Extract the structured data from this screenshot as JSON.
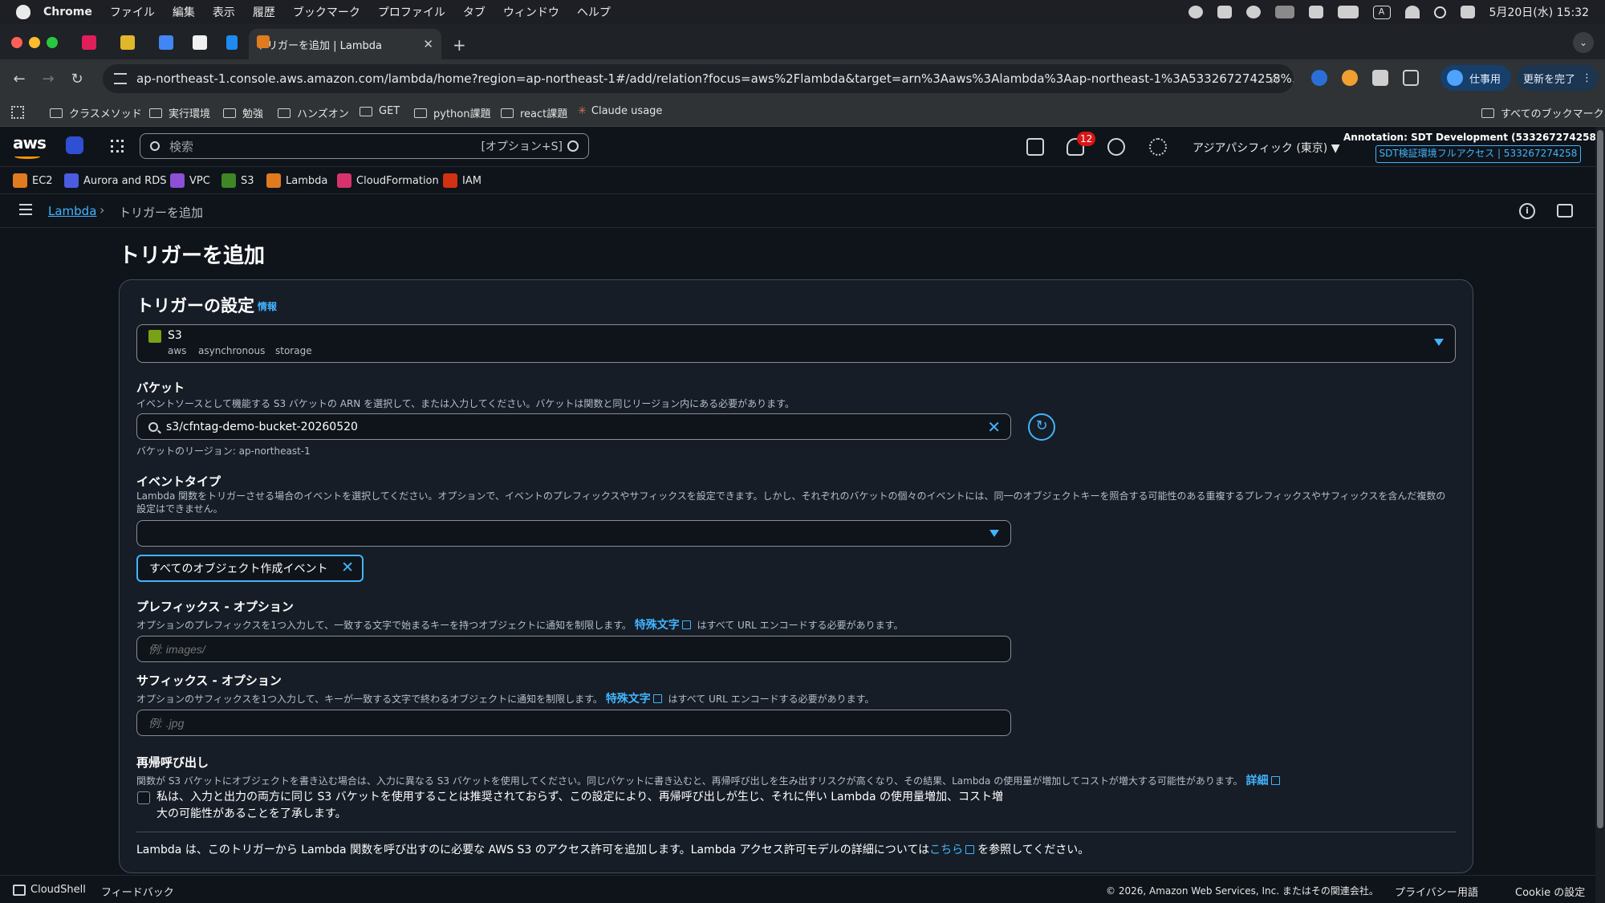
{
  "mac_menubar": {
    "app": "Chrome",
    "menus": [
      "ファイル",
      "編集",
      "表示",
      "履歴",
      "ブックマーク",
      "プロファイル",
      "タブ",
      "ウィンドウ",
      "ヘルプ"
    ],
    "clock": "5月20日(水) 15:32",
    "input_mode": "A"
  },
  "browser": {
    "active_tab_title": "トリガーを追加 | Lambda",
    "url": "ap-northeast-1.console.aws.amazon.com/lambda/home?region=ap-northeast-1#/add/relation?focus=aws%2Flambda&target=arn%3Aaws%3Alambda%3Aap-northeast-1%3A533267274258%3Afunction...",
    "profile_label": "仕事用",
    "update_label": "更新を完了",
    "bookmarks": [
      "クラスメソッド",
      "実行環境",
      "勉強",
      "ハンズオン",
      "GET",
      "python課題",
      "react課題",
      "Claude usage"
    ],
    "all_bookmarks_label": "すべてのブックマーク"
  },
  "aws_header": {
    "logo": "aws",
    "search_placeholder": "検索",
    "search_shortcut": "[オプション+S]",
    "notification_count": "12",
    "region": "アジアパシフィック (東京) ▼",
    "account_name": "Annotation: SDT Development (533267274258) ▼",
    "account_role": "SDT検証環境フルアクセス | 533267274258"
  },
  "favorites": [
    {
      "label": "EC2",
      "color": "#e07b1f"
    },
    {
      "label": "Aurora and RDS",
      "color": "#4a5ce0"
    },
    {
      "label": "VPC",
      "color": "#8c4fd6"
    },
    {
      "label": "S3",
      "color": "#3f8624"
    },
    {
      "label": "Lambda",
      "color": "#e07b1f"
    },
    {
      "label": "CloudFormation",
      "color": "#d6336c"
    },
    {
      "label": "IAM",
      "color": "#d13212"
    }
  ],
  "breadcrumb": {
    "root": "Lambda",
    "current": "トリガーを追加"
  },
  "page": {
    "title": "トリガーを追加",
    "panel_title": "トリガーの設定",
    "panel_info": "情報",
    "source": {
      "name": "S3",
      "tags": [
        "aws",
        "asynchronous",
        "storage"
      ]
    },
    "bucket": {
      "label": "バケット",
      "description": "イベントソースとして機能する S3 バケットの ARN を選択して、または入力してください。バケットは関数と同じリージョン内にある必要があります。",
      "value": "s3/cfntag-demo-bucket-20260520",
      "region_note": "バケットのリージョン: ap-northeast-1"
    },
    "event_type": {
      "label": "イベントタイプ",
      "description": "Lambda 関数をトリガーさせる場合のイベントを選択してください。オプションで、イベントのプレフィックスやサフィックスを設定できます。しかし、それぞれのバケットの個々のイベントには、同一のオブジェクトキーを照合する可能性のある重複するプレフィックスやサフィックスを含んだ複数の設定はできません。",
      "selected_token": "すべてのオブジェクト作成イベント"
    },
    "prefix": {
      "label": "プレフィックス - オプション",
      "description_before": "オプションのプレフィックスを1つ入力して、一致する文字で始まるキーを持つオブジェクトに通知を制限します。",
      "link": "特殊文字",
      "description_after": "はすべて URL エンコードする必要があります。",
      "placeholder": "例: images/"
    },
    "suffix": {
      "label": "サフィックス - オプション",
      "description_before": "オプションのサフィックスを1つ入力して、キーが一致する文字で終わるオブジェクトに通知を制限します。",
      "link": "特殊文字",
      "description_after": "はすべて URL エンコードする必要があります。",
      "placeholder": "例: .jpg"
    },
    "recursive": {
      "label": "再帰呼び出し",
      "description": "関数が S3 バケットにオブジェクトを書き込む場合は、入力に異なる S3 バケットを使用してください。同じバケットに書き込むと、再帰呼び出しを生み出すリスクが高くなり、その結果、Lambda の使用量が増加してコストが増大する可能性があります。",
      "link": "詳細",
      "checkbox_text": "私は、入力と出力の両方に同じ S3 バケットを使用することは推奨されておらず、この設定により、再帰呼び出しが生じ、それに伴い Lambda の使用量増加、コスト増大の可能性があることを了承します。",
      "checked": false
    },
    "permission_note_before": "Lambda は、このトリガーから Lambda 関数を呼び出すのに必要な AWS S3 のアクセス許可を追加します。Lambda アクセス許可モデルの詳細については",
    "permission_note_link": "こちら",
    "permission_note_after": "を参照してください。"
  },
  "footer": {
    "cloudshell": "CloudShell",
    "feedback": "フィードバック",
    "copyright": "© 2026, Amazon Web Services, Inc. またはその関連会社。",
    "privacy": "プライバシー",
    "terms": "用語",
    "cookie": "Cookie の設定"
  }
}
